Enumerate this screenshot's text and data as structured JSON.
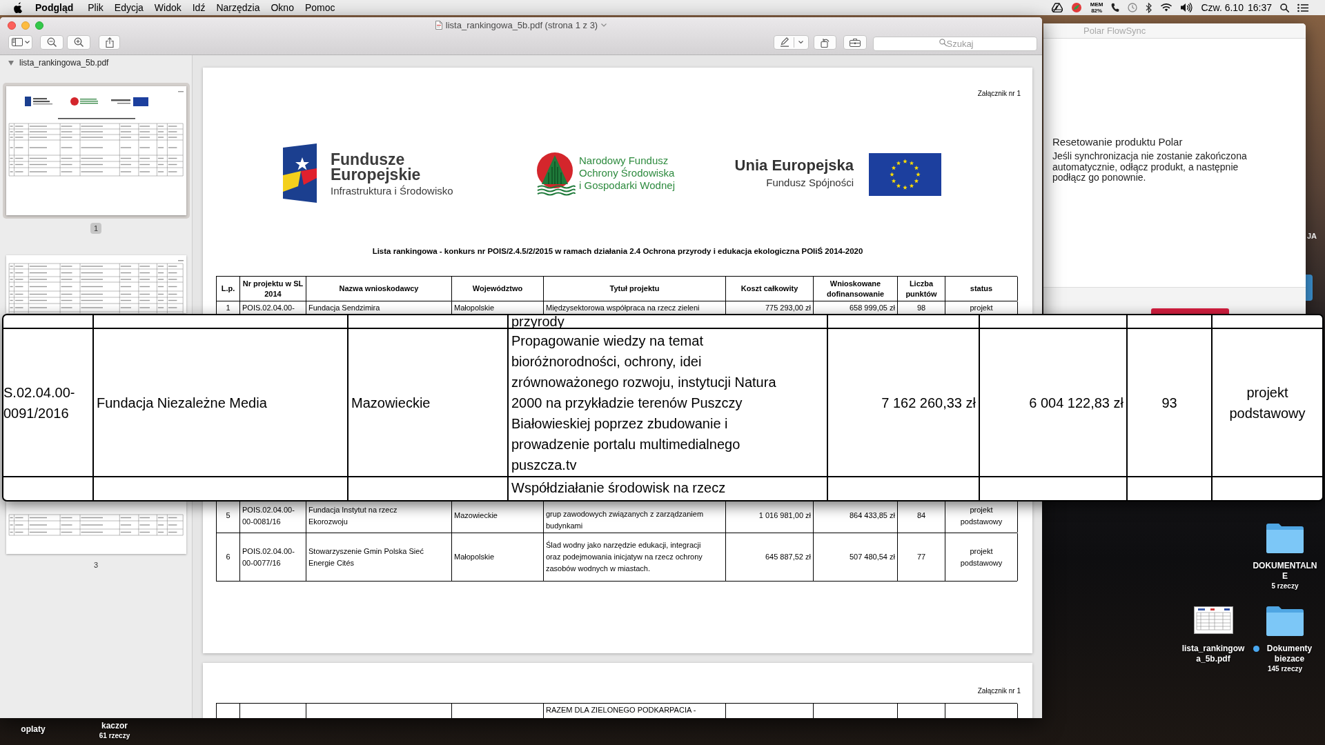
{
  "menu_bar": {
    "app_name": "Podgląd",
    "menus": [
      "Plik",
      "Edycja",
      "Widok",
      "Idź",
      "Narzędzia",
      "Okno",
      "Pomoc"
    ],
    "memory_label": "MEM",
    "memory_value": "82%",
    "date": "Czw. 6.10",
    "time": "16:37"
  },
  "preview_window": {
    "title": "lista_rankingowa_5b.pdf (strona 1 z 3)",
    "search": {
      "placeholder": "Szukaj"
    },
    "sidebar": {
      "file_name": "lista_rankingowa_5b.pdf",
      "expanded": true,
      "thumbnails": [
        {
          "label": "1",
          "selected": true
        },
        {
          "selected": false
        },
        {
          "label": "3",
          "selected": false
        }
      ]
    },
    "pages": [
      {
        "annex": "Załącznik nr 1",
        "logos": [
          {
            "kind": "flag",
            "lines": [
              "Fundusze",
              "Europejskie",
              "Infrastruktura i Środowisko"
            ]
          },
          {
            "kind": "tree",
            "lines": [
              "Narodowy Fundusz",
              "Ochrony Środowiska",
              "i Gospodarki Wodnej"
            ]
          },
          {
            "kind": "stars",
            "lines": [
              "Unia Europejska",
              "Fundusz Spójności"
            ]
          }
        ],
        "heading": "Lista rankingowa - konkurs nr POIS/2.4.5/2/2015 w ramach działania 2.4 Ochrona przyrody i edukacja ekologiczna POIiŚ 2014-2020",
        "table": {
          "columns": [
            "L.p.",
            "Nr projektu w SL\n2014",
            "Nazwa wnioskodawcy",
            "Województwo",
            "Tytuł projektu",
            "Koszt całkowity",
            "Wnioskowane\ndofinansowanie",
            "Liczba\npunktów",
            "status"
          ],
          "rows": [
            {
              "kind": "top_visible",
              "lp": "1",
              "number": "POIS.02.04.00-",
              "applicant": "Fundacja Sendzimira",
              "region": "Małopolskie",
              "title": "Międzysektorowa współpraca na rzecz zieleni",
              "cost": "775 293,00 zł",
              "grant": "658 999,05 zł",
              "points": "98",
              "status": "projekt"
            },
            {
              "kind": "bottom_visible",
              "lp": "5",
              "number": "POIS.02.04.00-\n00-0081/16",
              "applicant": "Fundacja Instytut na rzecz\nEkorozwoju",
              "region": "Mazowieckie",
              "title": "grup zawodowych związanych z zarządzaniem\nbudynkami",
              "cost": "1 016 981,00 zł",
              "grant": "864 433,85 zł",
              "points": "84",
              "status": "projekt\npodstawowy"
            },
            {
              "kind": "whole",
              "lp": "6",
              "number": "POIS.02.04.00-\n00-0077/16",
              "applicant": "Stowarzyszenie Gmin Polska Sieć\nEnergie Cités",
              "region": "Małopolskie",
              "title": "Ślad wodny jako narzędzie edukacji, integracji\noraz podejmowania inicjatyw na rzecz ochrony\nzasobów wodnych w miastach.",
              "cost": "645 887,52 zł",
              "grant": "507 480,54 zł",
              "points": "77",
              "status": "projekt\npodstawowy"
            }
          ]
        }
      },
      {
        "annex": "Załącznik nr 1",
        "table": {
          "rows": [
            {
              "kind": "top_visible",
              "title": "RAZEM DLA ZIELONEGO PODKARPACIA -"
            }
          ]
        }
      }
    ]
  },
  "magnifier": {
    "rows": [
      {
        "kind": "top_edge",
        "title": "przyrody"
      },
      {
        "kind": "full",
        "number": "S.02.04.00-\n0091/2016",
        "applicant": "Fundacja Niezależne Media",
        "region": "Mazowieckie",
        "title": "Propagowanie wiedzy na temat\nbioróżnorodności, ochrony, idei\nzrównoważonego rozwoju, instytucji Natura\n2000 na przykładzie terenów Puszczy\nBiałowieskiej poprzez zbudowanie i\nprowadzenie portalu multimedialnego\npuszcza.tv",
        "cost": "7 162 260,33 zł",
        "grant": "6 004 122,83 zł",
        "points": "93",
        "status": "projekt\npodstawowy"
      },
      {
        "kind": "bottom_edge",
        "title": "Współdziałanie środowisk na rzecz"
      }
    ]
  },
  "flowsync_window": {
    "title": "Polar FlowSync",
    "heading": "Resetowanie produktu Polar",
    "message": "Jeśli synchronizacja nie zostanie zakończona automatycznie, odłącz produkt, a następnie podłącz go ponownie."
  },
  "desktop": {
    "edge_label": "JA",
    "items": [
      {
        "kind": "folder",
        "name": "DOKUMENTALNE",
        "count": "5 rzeczy"
      },
      {
        "kind": "document",
        "name": "lista_rankingowa_5b.pdf"
      },
      {
        "kind": "folder",
        "name": "Dokumenty biezace",
        "count": "145 rzeczy",
        "color": "#4aa8f0"
      },
      {
        "kind": "label",
        "name": "oplaty"
      },
      {
        "kind": "label",
        "name": "kaczor",
        "count": "61 rzeczy"
      }
    ]
  }
}
